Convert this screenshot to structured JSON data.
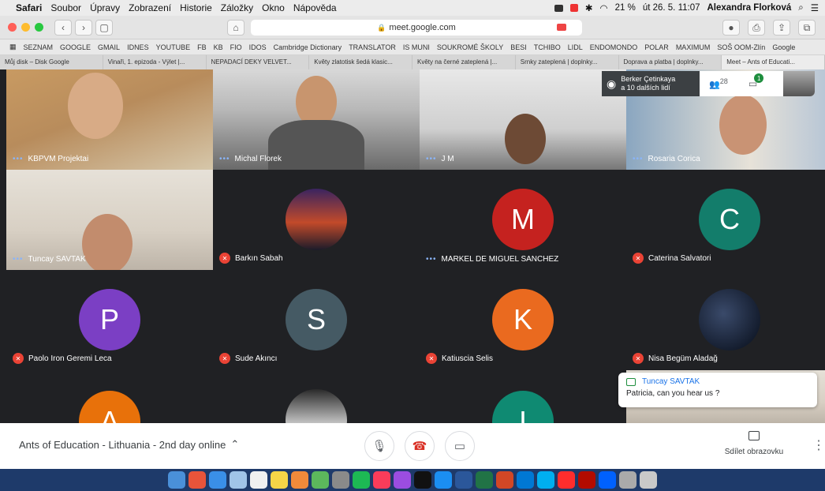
{
  "menubar": {
    "app": "Safari",
    "items": [
      "Soubor",
      "Úpravy",
      "Zobrazení",
      "Historie",
      "Záložky",
      "Okno",
      "Nápověda"
    ],
    "battery": "21 %",
    "datetime": "út 26. 5. 11:07",
    "user": "Alexandra Florková"
  },
  "toolbar": {
    "url": "meet.google.com"
  },
  "bookmarks": [
    "SEZNAM",
    "GOOGLE",
    "GMAIL",
    "IDNES",
    "YOUTUBE",
    "FB",
    "KB",
    "FIO",
    "IDOS",
    "Cambridge Dictionary",
    "TRANSLATOR",
    "IS MUNI",
    "SOUKROMÉ ŠKOLY",
    "BESI",
    "TCHIBO",
    "LIDL",
    "ENDOMONDO",
    "POLAR",
    "MAXIMUM",
    "SOŠ OOM-Zlín",
    "Google"
  ],
  "tabs": [
    "Můj disk – Disk Google",
    "Vinaři, 1. epizoda - Výlet |...",
    "NEPADACÍ DEKY VELVET...",
    "Květy zlatotisk šedá klasic...",
    "Květy na černé zateplená |...",
    "Srnky zateplená | doplnky...",
    "Doprava a platba | doplnky...",
    "Meet – Ants of Educati..."
  ],
  "overlay": {
    "presenter": "Berker Çetinkaya",
    "others": "a 10 dalších lidí",
    "participants": "28",
    "chat_badge": "1"
  },
  "participants": [
    {
      "name": "KBPVM Projektai"
    },
    {
      "name": "Michal Florek"
    },
    {
      "name": "J M"
    },
    {
      "name": "Rosaria Corica"
    },
    {
      "name": "Tuncay SAVTAK"
    },
    {
      "name": "Barkın Sabah"
    },
    {
      "name": "MARKEL DE MIGUEL SANCHEZ",
      "initial": "M"
    },
    {
      "name": "Caterina Salvatori",
      "initial": "C"
    },
    {
      "name": "Paolo Iron Geremi Leca",
      "initial": "P"
    },
    {
      "name": "Sude Akıncı",
      "initial": "S"
    },
    {
      "name": "Katiuscia Selis",
      "initial": "K"
    },
    {
      "name": "Nisa Begüm Aladağ"
    },
    {
      "initial": "A"
    },
    {
      "initial": "I"
    }
  ],
  "toast": {
    "sender": "Tuncay SAVTAK",
    "message": "Patricia, can you hear us ?"
  },
  "bottombar": {
    "meeting_title": "Ants of Education - Lithuania - 2nd day online",
    "present_label": "Sdílet obrazovku"
  },
  "colors": {
    "avatar_m": "#c5221f",
    "avatar_c": "#137d6b",
    "avatar_p": "#7b3fc4",
    "avatar_s": "#455a64",
    "avatar_k": "#ea6a1f",
    "avatar_a": "#e8710a",
    "avatar_i": "#0f8a72"
  }
}
